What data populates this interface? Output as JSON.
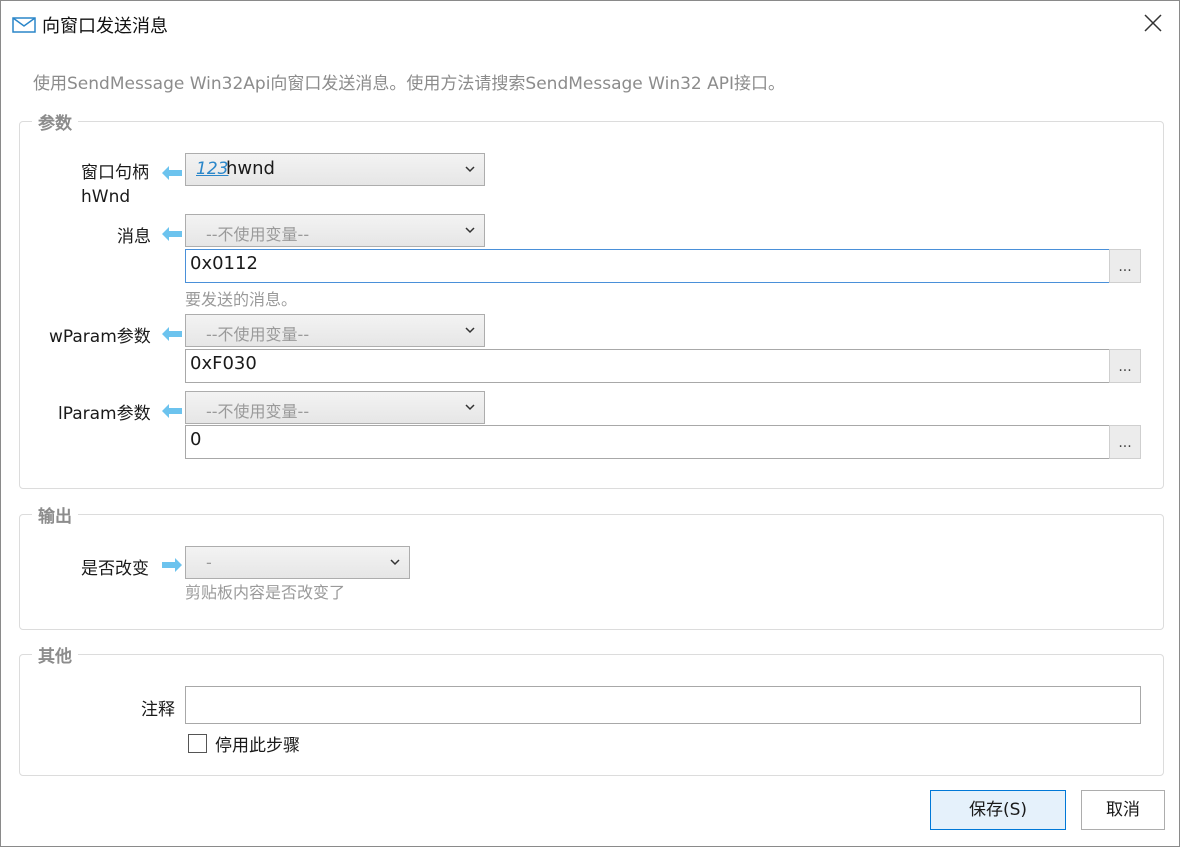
{
  "window": {
    "title": "向窗口发送消息",
    "description": "使用SendMessage Win32Api向窗口发送消息。使用方法请搜索SendMessage Win32 API接口。"
  },
  "params": {
    "group_title": "参数",
    "hwnd": {
      "label_line1": "窗口句柄",
      "label_line2": "hWnd",
      "var_icon_text": "123",
      "value": "hwnd"
    },
    "message": {
      "label": "消息",
      "dropdown": "--不使用变量--",
      "value": "0x0112",
      "hint": "要发送的消息。",
      "button": "..."
    },
    "wparam": {
      "label": "wParam参数",
      "dropdown": "--不使用变量--",
      "value": "0xF030",
      "button": "..."
    },
    "lparam": {
      "label": "lParam参数",
      "dropdown": "--不使用变量--",
      "value": "0",
      "button": "..."
    }
  },
  "output": {
    "group_title": "输出",
    "changed": {
      "label": "是否改变",
      "dropdown": "-",
      "hint": "剪贴板内容是否改变了"
    }
  },
  "other": {
    "group_title": "其他",
    "comment_label": "注释",
    "comment_value": "",
    "disable_label": "停用此步骤",
    "disable_checked": false
  },
  "footer": {
    "save": "保存(S)",
    "cancel": "取消"
  },
  "colors": {
    "accent": "#0078d7",
    "arrow": "#6cc3ee",
    "var_icon": "#2a86c9"
  }
}
